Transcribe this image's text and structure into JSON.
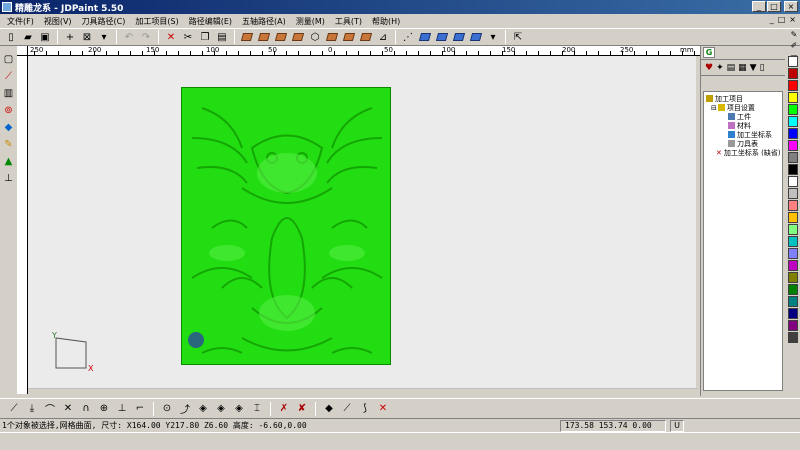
{
  "window": {
    "title": "精雕龙系 - JDPaint 5.50"
  },
  "menu": [
    "文件(F)",
    "视图(V)",
    "刀具路径(C)",
    "加工项目(S)",
    "路径编辑(E)",
    "五轴路径(A)",
    "测量(M)",
    "工具(T)",
    "帮助(H)"
  ],
  "ruler": {
    "labels": [
      "250",
      "200",
      "150",
      "100",
      "50",
      "0",
      "50",
      "100",
      "150",
      "200",
      "250"
    ],
    "unit": "mm"
  },
  "axes": {
    "x": "X",
    "y": "Y"
  },
  "tree": {
    "root": "加工项目",
    "settings": "项目设置",
    "workpiece": "工件",
    "material": "材料",
    "wcs": "加工坐标系",
    "tools": "刀具表",
    "wcs_default": "加工坐标系 (缺省)"
  },
  "palette": [
    "#ffffff",
    "#c00000",
    "#ff0000",
    "#ffff00",
    "#00ff00",
    "#00ffff",
    "#0000ff",
    "#ff00ff",
    "#808080",
    "#000000",
    "#ffffff",
    "#c0c0c0",
    "#ff8080",
    "#ffc000",
    "#80ff80",
    "#00c0c0",
    "#8080ff",
    "#c000c0",
    "#808000",
    "#008000",
    "#008080",
    "#000080",
    "#800080",
    "#404040"
  ],
  "status": {
    "message": "1个对象被选择,网格曲面, 尺寸: X164.00 Y217.80 Z6.60 高度: -6.60,0.00",
    "coords": "173.58 153.74 0.00",
    "mode": "U"
  }
}
